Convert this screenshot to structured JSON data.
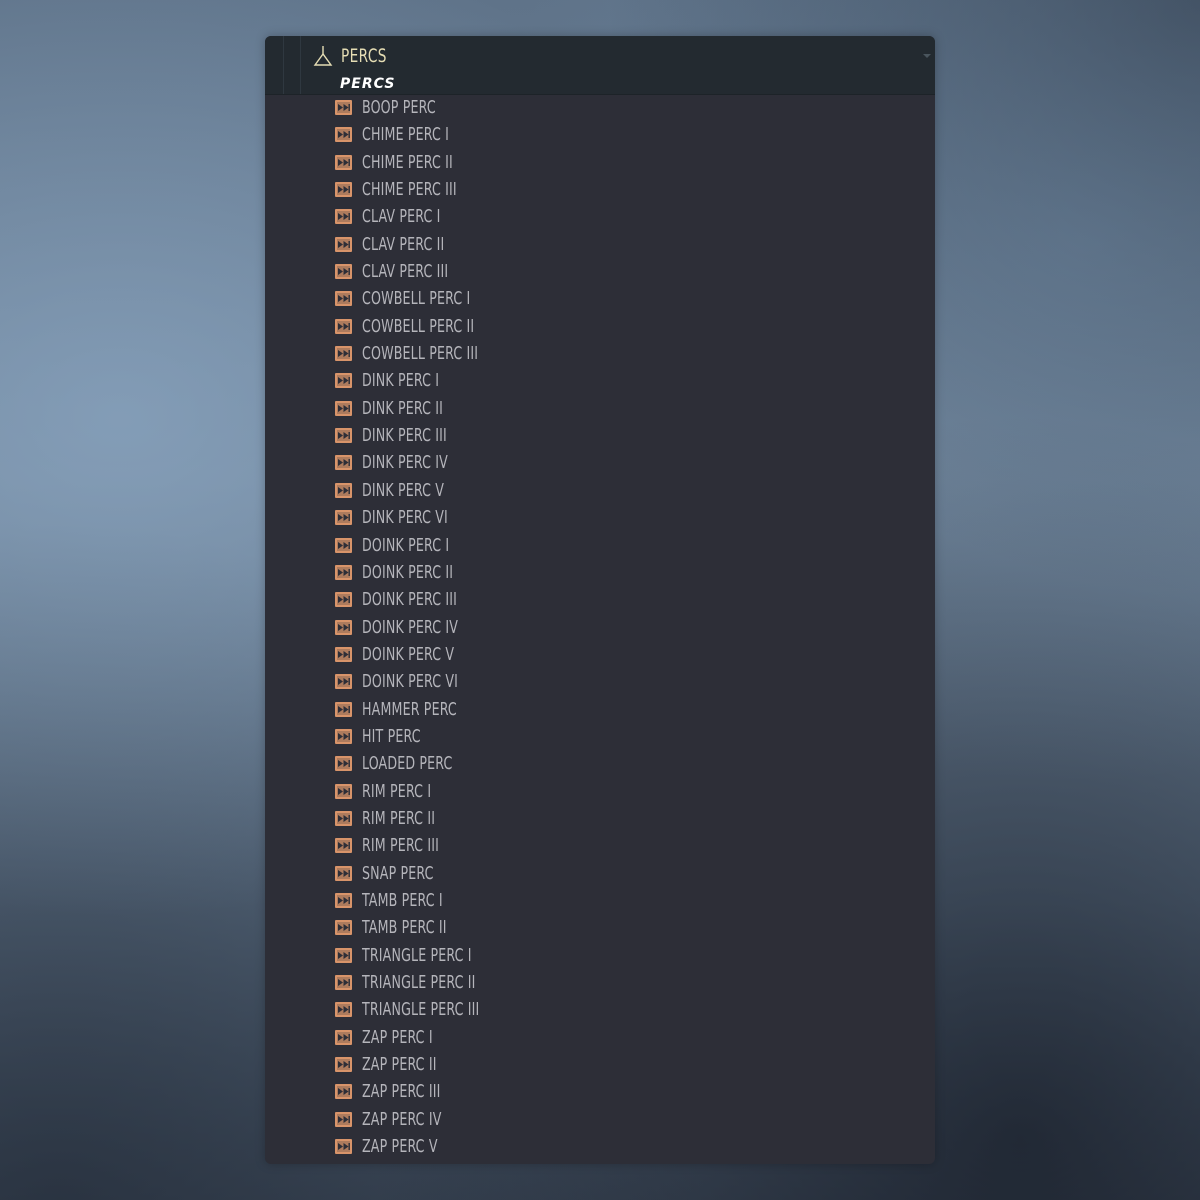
{
  "browser": {
    "folder": {
      "icon": "folder-open-icon",
      "label": "PERCS"
    },
    "banner": "PERCS",
    "item_icon": "audio-file-icon",
    "accent_color": "#d8946a",
    "items": [
      {
        "label": "BOOP PERC"
      },
      {
        "label": "CHIME PERC I"
      },
      {
        "label": "CHIME PERC II"
      },
      {
        "label": "CHIME PERC III"
      },
      {
        "label": "CLAV PERC I"
      },
      {
        "label": "CLAV PERC II"
      },
      {
        "label": "CLAV PERC III"
      },
      {
        "label": "COWBELL PERC I"
      },
      {
        "label": "COWBELL PERC II"
      },
      {
        "label": "COWBELL PERC III"
      },
      {
        "label": "DINK PERC I"
      },
      {
        "label": "DINK PERC II"
      },
      {
        "label": "DINK PERC III"
      },
      {
        "label": "DINK PERC IV"
      },
      {
        "label": "DINK PERC V"
      },
      {
        "label": "DINK PERC VI"
      },
      {
        "label": "DOINK PERC I"
      },
      {
        "label": "DOINK PERC II"
      },
      {
        "label": "DOINK PERC III"
      },
      {
        "label": "DOINK PERC IV"
      },
      {
        "label": "DOINK PERC V"
      },
      {
        "label": "DOINK PERC VI"
      },
      {
        "label": "HAMMER PERC"
      },
      {
        "label": "HIT PERC"
      },
      {
        "label": "LOADED PERC"
      },
      {
        "label": "RIM PERC I"
      },
      {
        "label": "RIM PERC II"
      },
      {
        "label": "RIM PERC III"
      },
      {
        "label": "SNAP PERC"
      },
      {
        "label": "TAMB PERC I"
      },
      {
        "label": "TAMB PERC II"
      },
      {
        "label": "TRIANGLE PERC I"
      },
      {
        "label": "TRIANGLE PERC II"
      },
      {
        "label": "TRIANGLE PERC III"
      },
      {
        "label": "ZAP PERC I"
      },
      {
        "label": "ZAP PERC II"
      },
      {
        "label": "ZAP PERC III"
      },
      {
        "label": "ZAP PERC IV"
      },
      {
        "label": "ZAP PERC V"
      }
    ]
  }
}
